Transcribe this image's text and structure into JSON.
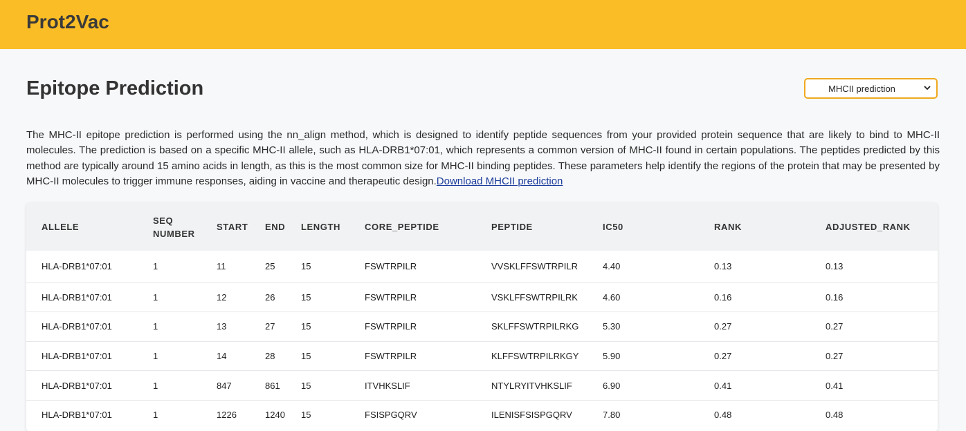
{
  "header": {
    "brand": "Prot2Vac"
  },
  "main": {
    "title": "Epitope Prediction",
    "prediction_select": {
      "selected": "MHCII prediction"
    },
    "description": "The MHC-II epitope prediction is performed using the nn_align method, which is designed to identify peptide sequences from your provided protein sequence that are likely to bind to MHC-II molecules. The prediction is based on a specific MHC-II allele, such as HLA-DRB1*07:01, which represents a common version of MHC-II found in certain populations. The peptides predicted by this method are typically around 15 amino acids in length, as this is the most common size for MHC-II binding peptides. These parameters help identify the regions of the protein that may be presented by MHC-II molecules to trigger immune responses, aiding in vaccine and therapeutic design.",
    "download_link": "Download MHCII prediction"
  },
  "table": {
    "columns": [
      "ALLELE",
      "SEQ NUMBER",
      "START",
      "END",
      "LENGTH",
      "CORE_PEPTIDE",
      "PEPTIDE",
      "IC50",
      "RANK",
      "ADJUSTED_RANK"
    ],
    "rows": [
      [
        "HLA-DRB1*07:01",
        "1",
        "11",
        "25",
        "15",
        "FSWTRPILR",
        "VVSKLFFSWTRPILR",
        "4.40",
        "0.13",
        "0.13"
      ],
      [
        "HLA-DRB1*07:01",
        "1",
        "12",
        "26",
        "15",
        "FSWTRPILR",
        "VSKLFFSWTRPILRK",
        "4.60",
        "0.16",
        "0.16"
      ],
      [
        "HLA-DRB1*07:01",
        "1",
        "13",
        "27",
        "15",
        "FSWTRPILR",
        "SKLFFSWTRPILRKG",
        "5.30",
        "0.27",
        "0.27"
      ],
      [
        "HLA-DRB1*07:01",
        "1",
        "14",
        "28",
        "15",
        "FSWTRPILR",
        "KLFFSWTRPILRKGY",
        "5.90",
        "0.27",
        "0.27"
      ],
      [
        "HLA-DRB1*07:01",
        "1",
        "847",
        "861",
        "15",
        "ITVHKSLIF",
        "NTYLRYITVHKSLIF",
        "6.90",
        "0.41",
        "0.41"
      ],
      [
        "HLA-DRB1*07:01",
        "1",
        "1226",
        "1240",
        "15",
        "FSISPGQRV",
        "ILENISFSISPGQRV",
        "7.80",
        "0.48",
        "0.48"
      ]
    ]
  }
}
